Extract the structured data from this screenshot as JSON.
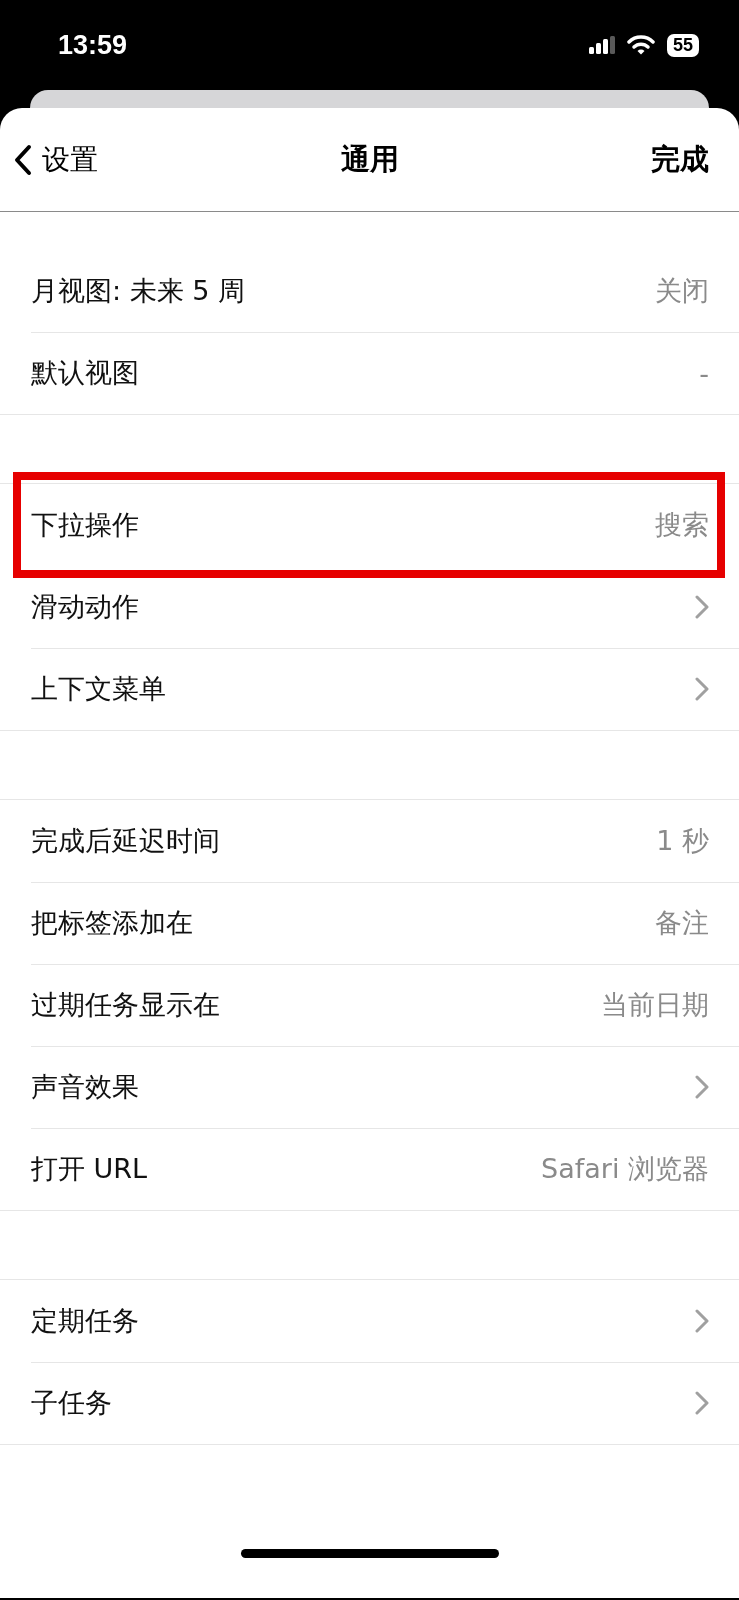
{
  "status_bar": {
    "time": "13:59",
    "battery": "55"
  },
  "nav": {
    "back": "设置",
    "title": "通用",
    "done": "完成"
  },
  "sections": [
    {
      "rows": [
        {
          "label": "月视图: 未来 5 周",
          "value": "关闭",
          "kind": "value",
          "highlighted": false
        },
        {
          "label": "默认视图",
          "value": "-",
          "kind": "value",
          "highlighted": false
        }
      ]
    },
    {
      "rows": [
        {
          "label": "下拉操作",
          "value": "搜索",
          "kind": "value",
          "highlighted": true
        },
        {
          "label": "滑动动作",
          "kind": "chevron",
          "highlighted": false
        },
        {
          "label": "上下文菜单",
          "kind": "chevron",
          "highlighted": false
        }
      ]
    },
    {
      "rows": [
        {
          "label": "完成后延迟时间",
          "value": "1 秒",
          "kind": "value",
          "highlighted": false
        },
        {
          "label": "把标签添加在",
          "value": "备注",
          "kind": "value",
          "highlighted": false
        },
        {
          "label": "过期任务显示在",
          "value": "当前日期",
          "kind": "value",
          "highlighted": false
        },
        {
          "label": "声音效果",
          "kind": "chevron",
          "highlighted": false
        },
        {
          "label": "打开 URL",
          "value": "Safari 浏览器",
          "kind": "value",
          "highlighted": false
        }
      ]
    },
    {
      "rows": [
        {
          "label": "定期任务",
          "kind": "chevron",
          "highlighted": false
        },
        {
          "label": "子任务",
          "kind": "chevron",
          "highlighted": false
        }
      ]
    }
  ]
}
